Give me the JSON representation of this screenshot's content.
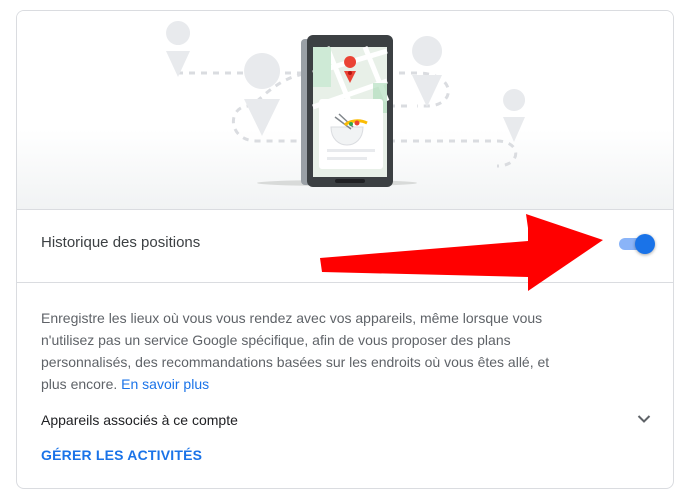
{
  "section": {
    "title": "Historique des positions",
    "toggle_state": "on"
  },
  "description": {
    "text": "Enregistre les lieux où vous vous rendez avec vos appareils, même lorsque vous n'utilisez pas un service Google spécifique, afin de vous proposer des plans personnalisés, des recommandations basées sur les endroits où vous êtes allé, et plus encore. ",
    "link": "En savoir plus"
  },
  "devices": {
    "label": "Appareils associés à ce compte",
    "icon": "chevron-down-icon"
  },
  "manage": {
    "label": "GÉRER LES ACTIVITÉS"
  },
  "illustration": {
    "icons": [
      "map-pin-icon",
      "phone-map-icon",
      "food-bowl-icon"
    ]
  },
  "annotation": {
    "icon": "red-arrow-icon",
    "color": "#ff0000"
  },
  "colors": {
    "accent": "#1a73e8",
    "toggle_track": "#8ab4f8",
    "text_primary": "#202124",
    "text_secondary": "#5f6368",
    "divider": "#dadce0",
    "map_marker": "#ea4335"
  }
}
